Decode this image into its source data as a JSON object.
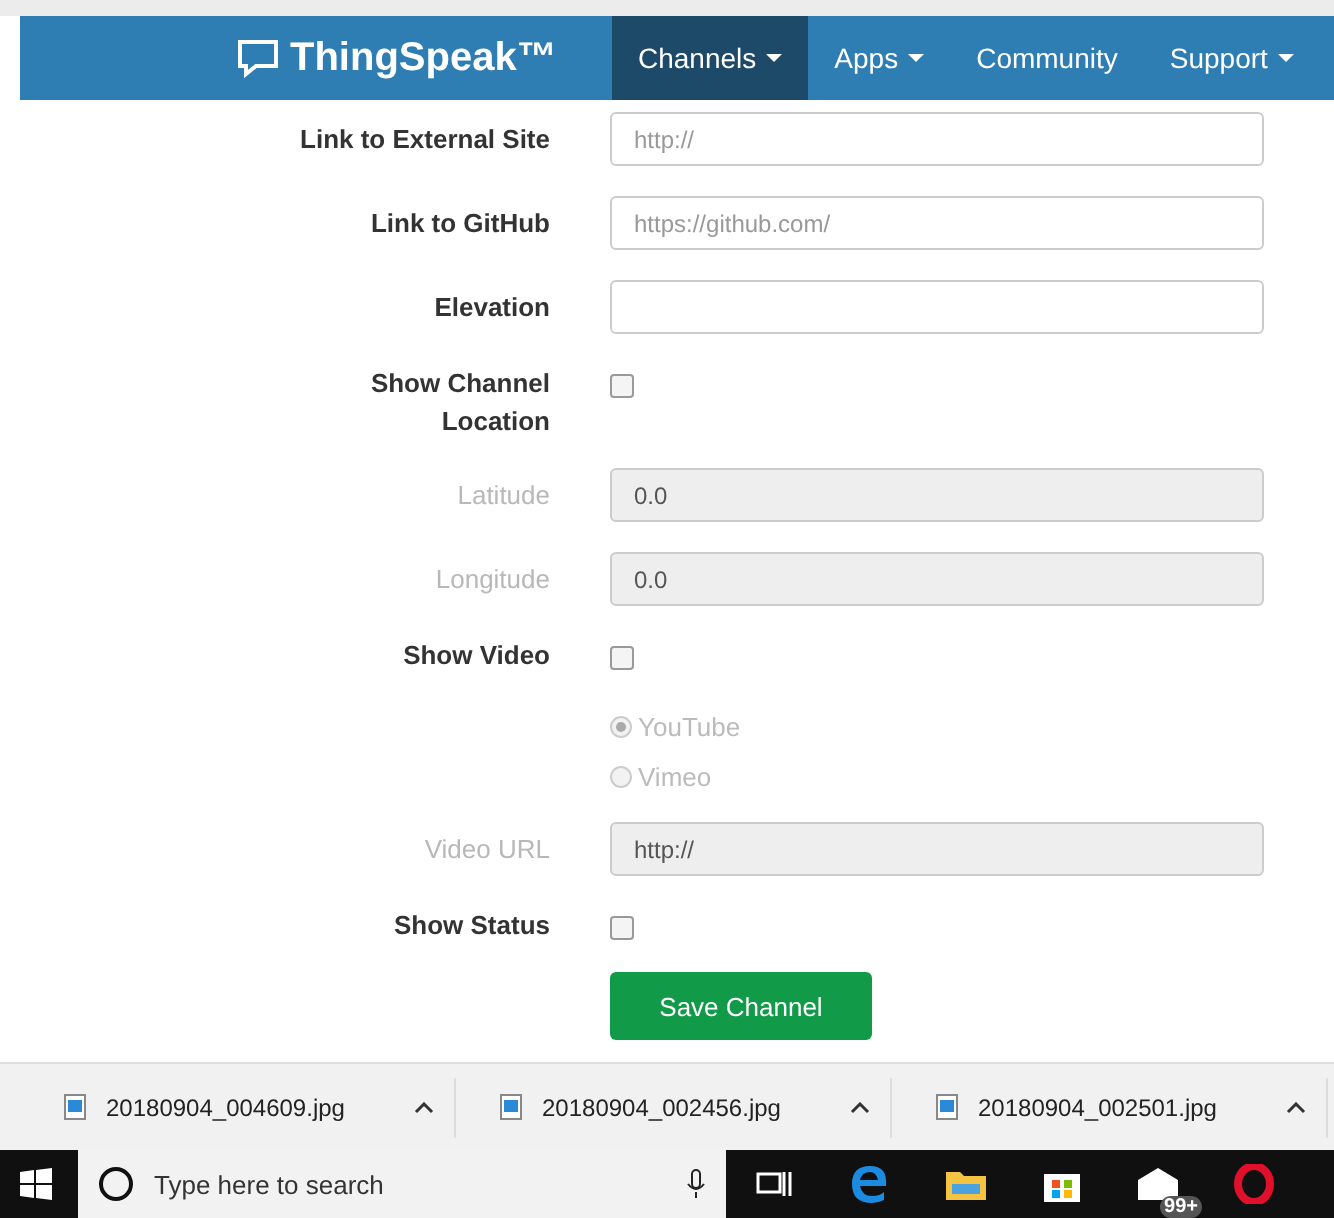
{
  "header": {
    "logo": "ThingSpeak™",
    "nav": [
      {
        "label": "Channels",
        "selected": true,
        "dropdown": true
      },
      {
        "label": "Apps",
        "selected": false,
        "dropdown": true
      },
      {
        "label": "Community",
        "selected": false,
        "dropdown": false
      },
      {
        "label": "Support",
        "selected": false,
        "dropdown": true
      }
    ]
  },
  "form": {
    "rows": [
      {
        "kind": "text",
        "label": "Link to External Site",
        "placeholder": "http://",
        "disabled": false
      },
      {
        "kind": "text",
        "label": "Link to GitHub",
        "placeholder": "https://github.com/",
        "disabled": false
      },
      {
        "kind": "text",
        "label": "Elevation",
        "disabled": false
      },
      {
        "kind": "checkbox",
        "label": "Show Channel Location",
        "checked": false
      },
      {
        "kind": "text",
        "label": "Latitude",
        "value": "0.0",
        "disabled": true
      },
      {
        "kind": "text",
        "label": "Longitude",
        "value": "0.0",
        "disabled": true
      },
      {
        "kind": "checkbox",
        "label": "Show Video",
        "checked": false
      },
      {
        "kind": "radio",
        "disabled": true,
        "options": [
          {
            "label": "YouTube",
            "selected": true
          },
          {
            "label": "Vimeo",
            "selected": false
          }
        ]
      },
      {
        "kind": "text",
        "label": "Video URL",
        "value": "http://",
        "disabled": true
      },
      {
        "kind": "checkbox",
        "label": "Show Status",
        "checked": false
      },
      {
        "kind": "button",
        "label": "Save Channel"
      }
    ]
  },
  "downloads": [
    {
      "name": "20180904_004609.jpg"
    },
    {
      "name": "20180904_002456.jpg"
    },
    {
      "name": "20180904_002501.jpg"
    }
  ],
  "taskbar": {
    "search_placeholder": "Type here to search",
    "mail_badge": "99+"
  }
}
